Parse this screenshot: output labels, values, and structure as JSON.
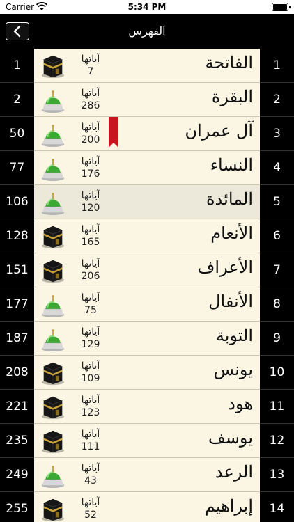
{
  "status_bar": {
    "carrier": "Carrier",
    "time": "5:34 PM"
  },
  "nav": {
    "title": "الفهرس"
  },
  "colors": {
    "background": "#000000",
    "row_background": "#fbf6e4",
    "highlight": "#ece8da",
    "bookmark": "#c8141e"
  },
  "ayat_label": "آياتها",
  "rows": [
    {
      "page": "1",
      "surah_number": "1",
      "name": "الفاتحة",
      "ayat": "7",
      "type": "kaaba-icon"
    },
    {
      "page": "2",
      "surah_number": "2",
      "name": "البقرة",
      "ayat": "286",
      "type": "dome-icon"
    },
    {
      "page": "50",
      "surah_number": "3",
      "name": "آل عمران",
      "ayat": "200",
      "type": "dome-icon",
      "bookmarked": true
    },
    {
      "page": "77",
      "surah_number": "4",
      "name": "النساء",
      "ayat": "176",
      "type": "dome-icon"
    },
    {
      "page": "106",
      "surah_number": "5",
      "name": "المائدة",
      "ayat": "120",
      "type": "dome-icon",
      "highlighted": true
    },
    {
      "page": "128",
      "surah_number": "6",
      "name": "الأنعام",
      "ayat": "165",
      "type": "kaaba-icon"
    },
    {
      "page": "151",
      "surah_number": "7",
      "name": "الأعراف",
      "ayat": "206",
      "type": "kaaba-icon"
    },
    {
      "page": "177",
      "surah_number": "8",
      "name": "الأنفال",
      "ayat": "75",
      "type": "dome-icon"
    },
    {
      "page": "187",
      "surah_number": "9",
      "name": "التوبة",
      "ayat": "129",
      "type": "dome-icon"
    },
    {
      "page": "208",
      "surah_number": "10",
      "name": "يونس",
      "ayat": "109",
      "type": "kaaba-icon"
    },
    {
      "page": "221",
      "surah_number": "11",
      "name": "هود",
      "ayat": "123",
      "type": "kaaba-icon"
    },
    {
      "page": "235",
      "surah_number": "12",
      "name": "يوسف",
      "ayat": "111",
      "type": "kaaba-icon"
    },
    {
      "page": "249",
      "surah_number": "13",
      "name": "الرعد",
      "ayat": "43",
      "type": "dome-icon"
    },
    {
      "page": "255",
      "surah_number": "14",
      "name": "إبراهيم",
      "ayat": "52",
      "type": "kaaba-icon"
    }
  ]
}
